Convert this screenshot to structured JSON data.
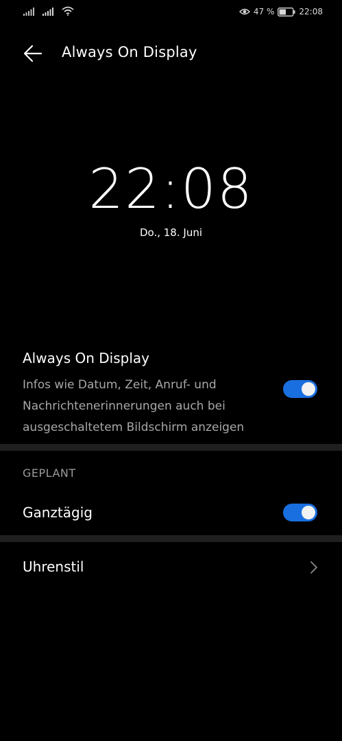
{
  "status_bar": {
    "battery_percent": "47 %",
    "time": "22:08",
    "icons": [
      "signal-icon",
      "signal-icon",
      "wifi-icon",
      "eye-icon",
      "battery-icon"
    ]
  },
  "app_bar": {
    "title": "Always On Display",
    "back_icon": "back-arrow-icon"
  },
  "preview": {
    "time": "22:08",
    "date": "Do., 18. Juni"
  },
  "aod_setting": {
    "title": "Always On Display",
    "description": "Infos wie Datum, Zeit, Anruf- und Nachrichtenerinnerungen auch bei ausgeschaltetem Bildschirm anzeigen",
    "enabled": true
  },
  "schedule": {
    "header": "GEPLANT",
    "all_day_label": "Ganztägig",
    "all_day_enabled": true
  },
  "clock_style": {
    "label": "Uhrenstil",
    "chevron_icon": "chevron-right-icon"
  },
  "colors": {
    "background": "#000000",
    "toggle_on": "#1a6fe0",
    "divider": "#1f1f1f",
    "secondary_text": "#a8a8a8"
  }
}
